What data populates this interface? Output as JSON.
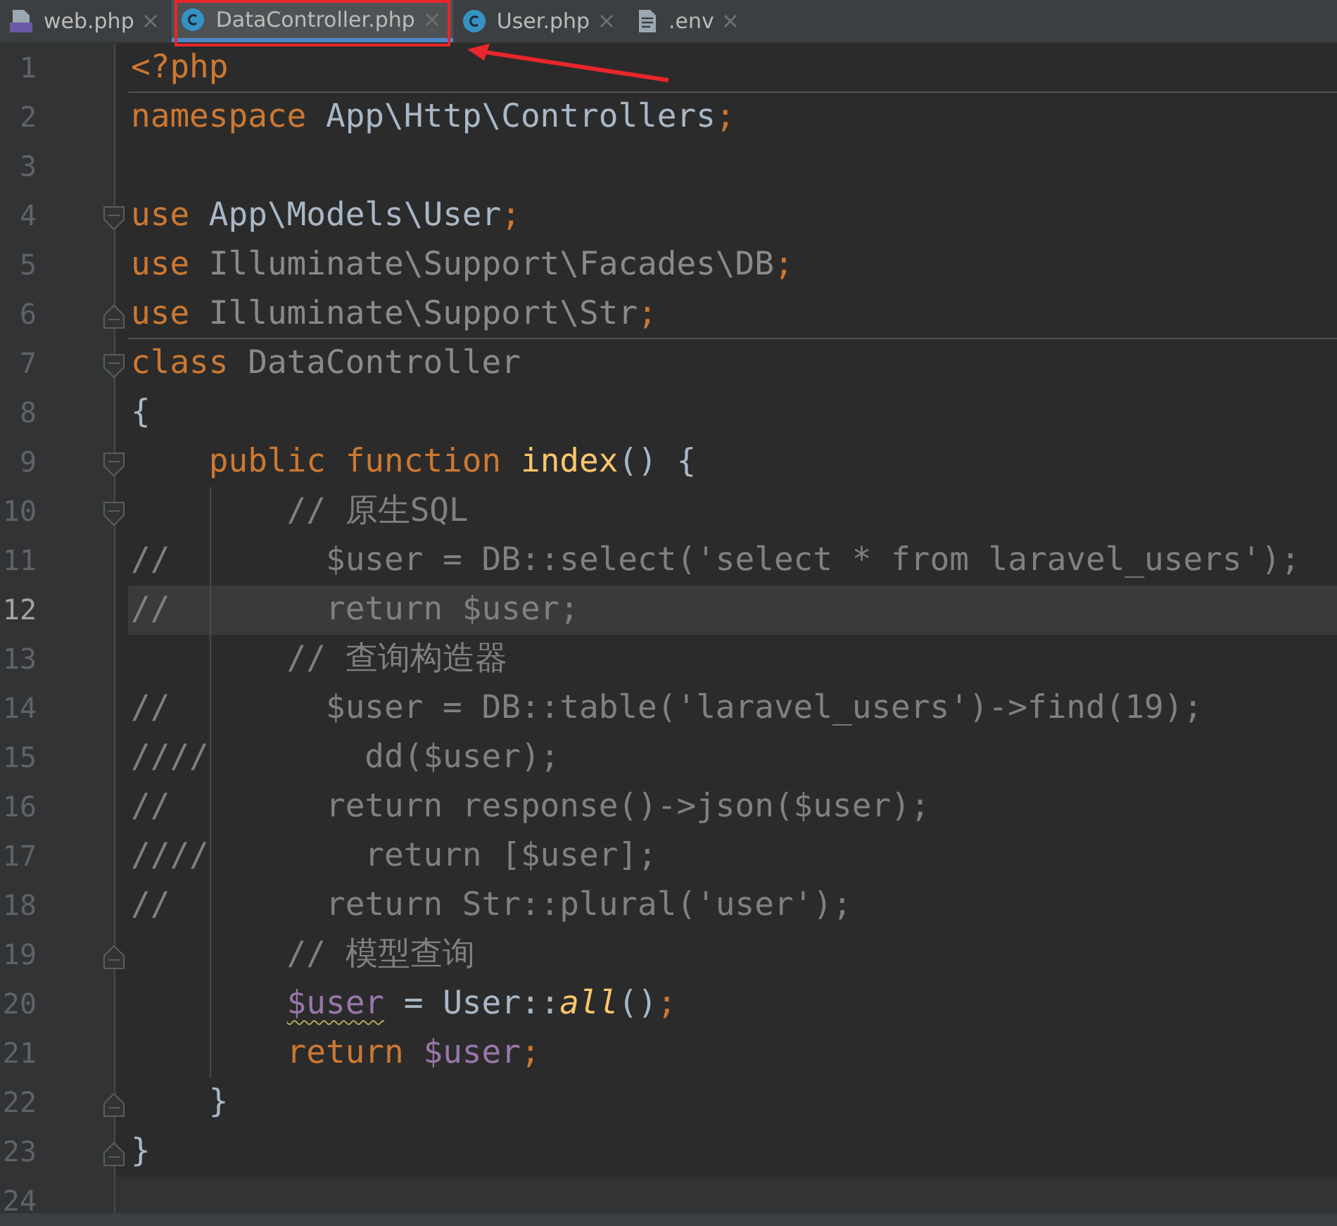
{
  "tabs": [
    {
      "label": "web.php",
      "kind": "php",
      "selected": false
    },
    {
      "label": "DataController.php",
      "kind": "class",
      "selected": true
    },
    {
      "label": "User.php",
      "kind": "class",
      "selected": false
    },
    {
      "label": ".env",
      "kind": "file",
      "selected": false
    }
  ],
  "editor": {
    "lines": [
      {
        "number": "1",
        "fold_open": false,
        "fold_close": false,
        "current": false,
        "separator": true,
        "guide": false,
        "tokens": [
          {
            "kind": "keyword",
            "text": "<?php"
          }
        ]
      },
      {
        "number": "2",
        "fold_open": false,
        "fold_close": false,
        "current": false,
        "separator": false,
        "guide": false,
        "tokens": [
          {
            "kind": "keyword",
            "text": "namespace"
          },
          {
            "kind": "plain",
            "text": " App\\Http\\Controllers"
          },
          {
            "kind": "punct",
            "text": ";"
          }
        ]
      },
      {
        "number": "3",
        "fold_open": false,
        "fold_close": false,
        "current": false
      },
      {
        "number": "4",
        "fold_open": true,
        "fold_close": false,
        "current": false,
        "separator": false,
        "guide": false,
        "tokens": [
          {
            "kind": "keyword",
            "text": "use"
          },
          {
            "kind": "plain",
            "text": " App\\Models\\User"
          },
          {
            "kind": "punct",
            "text": ";"
          }
        ]
      },
      {
        "number": "5",
        "fold_open": false,
        "fold_close": false,
        "current": false,
        "separator": false,
        "guide": false,
        "tokens": [
          {
            "kind": "keyword",
            "text": "use"
          },
          {
            "kind": "muted",
            "text": " Illuminate\\Support\\Facades\\DB"
          },
          {
            "kind": "punct",
            "text": ";"
          }
        ]
      },
      {
        "number": "6",
        "fold_open": false,
        "fold_close": true,
        "current": false,
        "separator": true,
        "guide": false,
        "tokens": [
          {
            "kind": "keyword",
            "text": "use"
          },
          {
            "kind": "muted",
            "text": " Illuminate\\Support\\Str"
          },
          {
            "kind": "punct",
            "text": ";"
          }
        ]
      },
      {
        "number": "7",
        "fold_open": true,
        "fold_close": false,
        "current": false,
        "separator": false,
        "guide": false,
        "tokens": [
          {
            "kind": "keyword",
            "text": "class"
          },
          {
            "kind": "muted",
            "text": " DataController"
          }
        ]
      },
      {
        "number": "8",
        "fold_open": false,
        "fold_close": false,
        "current": false,
        "separator": false,
        "guide": false,
        "tokens": [
          {
            "kind": "plain",
            "text": "{"
          }
        ]
      },
      {
        "number": "9",
        "fold_open": true,
        "fold_close": false,
        "current": false,
        "separator": false,
        "guide": false,
        "tokens": [
          {
            "kind": "keyword",
            "text": "    public function"
          },
          {
            "kind": "function",
            "text": " index"
          },
          {
            "kind": "plain",
            "text": "() {"
          }
        ]
      },
      {
        "number": "10",
        "fold_open": true,
        "fold_close": false,
        "current": false,
        "separator": false,
        "guide": true,
        "tokens": [
          {
            "kind": "comment",
            "text": "        // 原生SQL"
          }
        ]
      },
      {
        "number": "11",
        "fold_open": false,
        "fold_close": false,
        "current": false,
        "separator": false,
        "guide": true,
        "tokens": [
          {
            "kind": "comment",
            "text": "//        $user = DB::select('select * from laravel_users');"
          }
        ]
      },
      {
        "number": "12",
        "fold_open": false,
        "fold_close": false,
        "current": true,
        "separator": false,
        "guide": true,
        "tokens": [
          {
            "kind": "comment",
            "text": "//        return $user;"
          }
        ]
      },
      {
        "number": "13",
        "fold_open": false,
        "fold_close": false,
        "current": false,
        "separator": false,
        "guide": true,
        "tokens": [
          {
            "kind": "comment",
            "text": "        // 查询构造器"
          }
        ]
      },
      {
        "number": "14",
        "fold_open": false,
        "fold_close": false,
        "current": false,
        "separator": false,
        "guide": true,
        "tokens": [
          {
            "kind": "comment",
            "text": "//        $user = DB::table('laravel_users')->find(19);"
          }
        ]
      },
      {
        "number": "15",
        "fold_open": false,
        "fold_close": false,
        "current": false,
        "separator": false,
        "guide": true,
        "tokens": [
          {
            "kind": "comment",
            "text": "////        dd($user);"
          }
        ]
      },
      {
        "number": "16",
        "fold_open": false,
        "fold_close": false,
        "current": false,
        "separator": false,
        "guide": true,
        "tokens": [
          {
            "kind": "comment",
            "text": "//        return response()->json($user);"
          }
        ]
      },
      {
        "number": "17",
        "fold_open": false,
        "fold_close": false,
        "current": false,
        "separator": false,
        "guide": true,
        "tokens": [
          {
            "kind": "comment",
            "text": "////        return [$user];"
          }
        ]
      },
      {
        "number": "18",
        "fold_open": false,
        "fold_close": false,
        "current": false,
        "separator": false,
        "guide": true,
        "tokens": [
          {
            "kind": "comment",
            "text": "//        return Str::plural('user');"
          }
        ]
      },
      {
        "number": "19",
        "fold_open": false,
        "fold_close": true,
        "current": false,
        "separator": false,
        "guide": true,
        "tokens": [
          {
            "kind": "comment",
            "text": "        // 模型查询"
          }
        ]
      },
      {
        "number": "20",
        "fold_open": false,
        "fold_close": false,
        "current": false,
        "separator": false,
        "guide": true,
        "tokens": [
          {
            "kind": "warned-variable",
            "text": "        $user"
          },
          {
            "kind": "plain",
            "text": " = User::"
          },
          {
            "kind": "static",
            "text": "all"
          },
          {
            "kind": "plain",
            "text": "()"
          },
          {
            "kind": "punct",
            "text": ";"
          }
        ]
      },
      {
        "number": "21",
        "fold_open": false,
        "fold_close": false,
        "current": false,
        "separator": false,
        "guide": true,
        "tokens": [
          {
            "kind": "keyword",
            "text": "        return"
          },
          {
            "kind": "variable",
            "text": " $user"
          },
          {
            "kind": "punct",
            "text": ";"
          }
        ]
      },
      {
        "number": "22",
        "fold_open": false,
        "fold_close": true,
        "current": false,
        "separator": false,
        "guide": false,
        "tokens": [
          {
            "kind": "plain",
            "text": "    }"
          }
        ]
      },
      {
        "number": "23",
        "fold_open": false,
        "fold_close": true,
        "current": false,
        "separator": false,
        "guide": false,
        "tokens": [
          {
            "kind": "plain",
            "text": "}"
          }
        ]
      }
    ],
    "end_line": {
      "number": "24"
    }
  }
}
